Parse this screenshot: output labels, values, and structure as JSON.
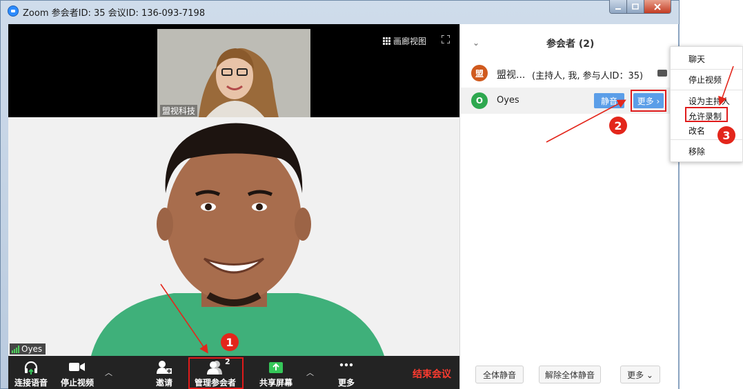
{
  "window": {
    "title": "Zoom 参会者ID: 35   会议ID: 136-093-7198",
    "buttons": [
      "minimize",
      "maximize",
      "close"
    ]
  },
  "video": {
    "gallery_view_label": "画廊视图",
    "thumbnail_name": "盟视科技",
    "main_speaker_name": "Oyes"
  },
  "toolbar": {
    "join_audio": "连接语音",
    "stop_video": "停止视频",
    "invite": "邀请",
    "manage_participants": "管理参会者",
    "participant_count": "2",
    "share_screen": "共享屏幕",
    "more": "更多",
    "end_meeting": "结束会议"
  },
  "panel": {
    "title": "参会者 (2)",
    "participants": [
      {
        "avatar_text": "盟",
        "avatar_color": "#d05a1e",
        "name": "盟视...",
        "meta": "(主持人, 我, 参与人ID：35)"
      },
      {
        "avatar_text": "O",
        "avatar_color": "#2ea84f",
        "name": "Oyes",
        "mute_label": "静音",
        "more_label": "更多 ›"
      }
    ],
    "footer": {
      "mute_all": "全体静音",
      "unmute_all": "解除全体静音",
      "more": "更多 ⌄"
    }
  },
  "context_menu": {
    "items": [
      "聊天",
      "停止视频",
      "设为主持人",
      "允许录制",
      "改名",
      "移除"
    ]
  },
  "annotations": {
    "badges": [
      "1",
      "2",
      "3"
    ],
    "accent_color": "#e3261b"
  }
}
